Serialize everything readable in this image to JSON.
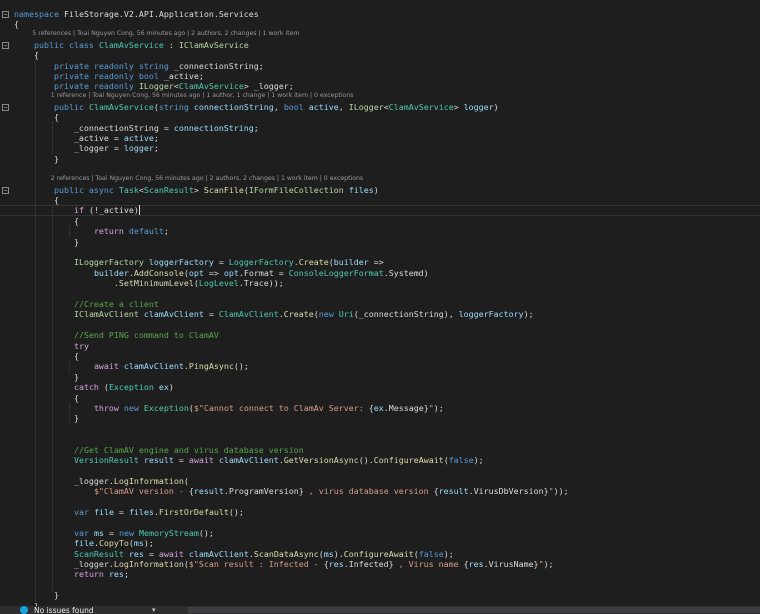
{
  "editor": {
    "lines": [
      [
        [
          "kw",
          "namespace"
        ],
        [
          "text",
          " FileStorage.V2.API.Application.Services"
        ]
      ],
      [
        [
          "text",
          "{"
        ]
      ],
      [
        [
          "text",
          "    "
        ],
        [
          "kw",
          "public class"
        ],
        [
          "text",
          " "
        ],
        [
          "type",
          "ClamAvService"
        ],
        [
          "text",
          " : "
        ],
        [
          "iface",
          "IClamAvService"
        ]
      ],
      [
        [
          "text",
          "    {"
        ]
      ],
      [
        [
          "text",
          "        "
        ],
        [
          "kw",
          "private readonly string"
        ],
        [
          "text",
          " _connectionString;"
        ]
      ],
      [
        [
          "text",
          "        "
        ],
        [
          "kw",
          "private readonly bool"
        ],
        [
          "text",
          " _active;"
        ]
      ],
      [
        [
          "text",
          "        "
        ],
        [
          "kw",
          "private readonly"
        ],
        [
          "text",
          " "
        ],
        [
          "iface",
          "ILogger"
        ],
        [
          "text",
          "<"
        ],
        [
          "type",
          "ClamAvService"
        ],
        [
          "text",
          "> _logger;"
        ]
      ],
      [
        [
          "text",
          "        "
        ],
        [
          "kw",
          "public"
        ],
        [
          "text",
          " "
        ],
        [
          "type",
          "ClamAvService"
        ],
        [
          "text",
          "("
        ],
        [
          "kw",
          "string"
        ],
        [
          "text",
          " "
        ],
        [
          "param",
          "connectionString"
        ],
        [
          "text",
          ", "
        ],
        [
          "kw",
          "bool"
        ],
        [
          "text",
          " "
        ],
        [
          "param",
          "active"
        ],
        [
          "text",
          ", "
        ],
        [
          "iface",
          "ILogger"
        ],
        [
          "text",
          "<"
        ],
        [
          "type",
          "ClamAvService"
        ],
        [
          "text",
          "> "
        ],
        [
          "param",
          "logger"
        ],
        [
          "text",
          ")"
        ]
      ],
      [
        [
          "text",
          "        {"
        ]
      ],
      [
        [
          "text",
          "            _connectionString = "
        ],
        [
          "param",
          "connectionString"
        ],
        [
          "text",
          ";"
        ]
      ],
      [
        [
          "text",
          "            _active = "
        ],
        [
          "param",
          "active"
        ],
        [
          "text",
          ";"
        ]
      ],
      [
        [
          "text",
          "            _logger = "
        ],
        [
          "param",
          "logger"
        ],
        [
          "text",
          ";"
        ]
      ],
      [
        [
          "text",
          "        }"
        ]
      ],
      [
        [
          "text",
          ""
        ]
      ],
      [
        [
          "text",
          "        "
        ],
        [
          "kw",
          "public async"
        ],
        [
          "text",
          " "
        ],
        [
          "type",
          "Task"
        ],
        [
          "text",
          "<"
        ],
        [
          "type",
          "ScanResult"
        ],
        [
          "text",
          "> "
        ],
        [
          "method",
          "ScanFile"
        ],
        [
          "text",
          "("
        ],
        [
          "iface",
          "IFormFileCollection"
        ],
        [
          "text",
          " "
        ],
        [
          "param",
          "files"
        ],
        [
          "text",
          ")"
        ]
      ],
      [
        [
          "text",
          "        {"
        ]
      ],
      [
        [
          "text",
          "            "
        ],
        [
          "ctl",
          "if"
        ],
        [
          "text",
          " (!_active)"
        ]
      ],
      [
        [
          "text",
          "            {"
        ]
      ],
      [
        [
          "text",
          "                "
        ],
        [
          "ctl",
          "return"
        ],
        [
          "text",
          " "
        ],
        [
          "kw",
          "default"
        ],
        [
          "text",
          ";"
        ]
      ],
      [
        [
          "text",
          "            }"
        ]
      ],
      [
        [
          "text",
          ""
        ]
      ],
      [
        [
          "text",
          "            "
        ],
        [
          "iface",
          "ILoggerFactory"
        ],
        [
          "text",
          " "
        ],
        [
          "param",
          "loggerFactory"
        ],
        [
          "text",
          " = "
        ],
        [
          "type",
          "LoggerFactory"
        ],
        [
          "text",
          "."
        ],
        [
          "method",
          "Create"
        ],
        [
          "text",
          "("
        ],
        [
          "param",
          "builder"
        ],
        [
          "text",
          " =>"
        ]
      ],
      [
        [
          "text",
          "                "
        ],
        [
          "param",
          "builder"
        ],
        [
          "text",
          "."
        ],
        [
          "method",
          "AddConsole"
        ],
        [
          "text",
          "("
        ],
        [
          "param",
          "opt"
        ],
        [
          "text",
          " => "
        ],
        [
          "param",
          "opt"
        ],
        [
          "text",
          ".Format = "
        ],
        [
          "type",
          "ConsoleLoggerFormat"
        ],
        [
          "text",
          ".Systemd)"
        ]
      ],
      [
        [
          "text",
          "                    ."
        ],
        [
          "method",
          "SetMinimumLevel"
        ],
        [
          "text",
          "("
        ],
        [
          "type",
          "LogLevel"
        ],
        [
          "text",
          ".Trace));"
        ]
      ],
      [
        [
          "text",
          ""
        ]
      ],
      [
        [
          "text",
          "            "
        ],
        [
          "cmt",
          "//Create a client"
        ]
      ],
      [
        [
          "text",
          "            "
        ],
        [
          "iface",
          "IClamAvClient"
        ],
        [
          "text",
          " "
        ],
        [
          "param",
          "clamAvClient"
        ],
        [
          "text",
          " = "
        ],
        [
          "type",
          "ClamAvClient"
        ],
        [
          "text",
          "."
        ],
        [
          "method",
          "Create"
        ],
        [
          "text",
          "("
        ],
        [
          "kw",
          "new"
        ],
        [
          "text",
          " "
        ],
        [
          "type",
          "Uri"
        ],
        [
          "text",
          "(_connectionString), "
        ],
        [
          "param",
          "loggerFactory"
        ],
        [
          "text",
          ");"
        ]
      ],
      [
        [
          "text",
          ""
        ]
      ],
      [
        [
          "text",
          "            "
        ],
        [
          "cmt",
          "//Send PING command to ClamAV"
        ]
      ],
      [
        [
          "text",
          "            "
        ],
        [
          "ctl",
          "try"
        ]
      ],
      [
        [
          "text",
          "            {"
        ]
      ],
      [
        [
          "text",
          "                "
        ],
        [
          "ctl",
          "await"
        ],
        [
          "text",
          " "
        ],
        [
          "param",
          "clamAvClient"
        ],
        [
          "text",
          "."
        ],
        [
          "method",
          "PingAsync"
        ],
        [
          "text",
          "();"
        ]
      ],
      [
        [
          "text",
          "            }"
        ]
      ],
      [
        [
          "text",
          "            "
        ],
        [
          "ctl",
          "catch"
        ],
        [
          "text",
          " ("
        ],
        [
          "type",
          "Exception"
        ],
        [
          "text",
          " "
        ],
        [
          "param",
          "ex"
        ],
        [
          "text",
          ")"
        ]
      ],
      [
        [
          "text",
          "            {"
        ]
      ],
      [
        [
          "text",
          "                "
        ],
        [
          "ctl",
          "throw"
        ],
        [
          "text",
          " "
        ],
        [
          "kw",
          "new"
        ],
        [
          "text",
          " "
        ],
        [
          "type",
          "Exception"
        ],
        [
          "text",
          "("
        ],
        [
          "str",
          "$\"Cannot connect to ClamAv Server: "
        ],
        [
          "text",
          "{"
        ],
        [
          "param",
          "ex"
        ],
        [
          "text",
          ".Message}"
        ],
        [
          "str",
          "\""
        ],
        [
          "text",
          ");"
        ]
      ],
      [
        [
          "text",
          "            }"
        ]
      ],
      [
        [
          "text",
          ""
        ]
      ],
      [
        [
          "text",
          ""
        ]
      ],
      [
        [
          "text",
          "            "
        ],
        [
          "cmt",
          "//Get ClamAV engine and virus database version"
        ]
      ],
      [
        [
          "text",
          "            "
        ],
        [
          "type",
          "VersionResult"
        ],
        [
          "text",
          " "
        ],
        [
          "param",
          "result"
        ],
        [
          "text",
          " = "
        ],
        [
          "ctl",
          "await"
        ],
        [
          "text",
          " "
        ],
        [
          "param",
          "clamAvClient"
        ],
        [
          "text",
          "."
        ],
        [
          "method",
          "GetVersionAsync"
        ],
        [
          "text",
          "()."
        ],
        [
          "method",
          "ConfigureAwait"
        ],
        [
          "text",
          "("
        ],
        [
          "kw",
          "false"
        ],
        [
          "text",
          ");"
        ]
      ],
      [
        [
          "text",
          ""
        ]
      ],
      [
        [
          "text",
          "            _logger."
        ],
        [
          "method",
          "LogInformation"
        ],
        [
          "text",
          "("
        ]
      ],
      [
        [
          "text",
          "                "
        ],
        [
          "str",
          "$\"ClamAV version - "
        ],
        [
          "text",
          "{"
        ],
        [
          "param",
          "result"
        ],
        [
          "text",
          ".ProgramVersion}"
        ],
        [
          "str",
          " , virus database version "
        ],
        [
          "text",
          "{"
        ],
        [
          "param",
          "result"
        ],
        [
          "text",
          ".VirusDbVersion}"
        ],
        [
          "str",
          "\""
        ],
        [
          "text",
          "));"
        ]
      ],
      [
        [
          "text",
          ""
        ]
      ],
      [
        [
          "text",
          "            "
        ],
        [
          "kw",
          "var"
        ],
        [
          "text",
          " "
        ],
        [
          "param",
          "file"
        ],
        [
          "text",
          " = "
        ],
        [
          "param",
          "files"
        ],
        [
          "text",
          "."
        ],
        [
          "method",
          "FirstOrDefault"
        ],
        [
          "text",
          "();"
        ]
      ],
      [
        [
          "text",
          ""
        ]
      ],
      [
        [
          "text",
          "            "
        ],
        [
          "kw",
          "var"
        ],
        [
          "text",
          " "
        ],
        [
          "param",
          "ms"
        ],
        [
          "text",
          " = "
        ],
        [
          "kw",
          "new"
        ],
        [
          "text",
          " "
        ],
        [
          "type",
          "MemoryStream"
        ],
        [
          "text",
          "();"
        ]
      ],
      [
        [
          "text",
          "            "
        ],
        [
          "param",
          "file"
        ],
        [
          "text",
          "."
        ],
        [
          "method",
          "CopyTo"
        ],
        [
          "text",
          "("
        ],
        [
          "param",
          "ms"
        ],
        [
          "text",
          ");"
        ]
      ],
      [
        [
          "text",
          "            "
        ],
        [
          "type",
          "ScanResult"
        ],
        [
          "text",
          " "
        ],
        [
          "param",
          "res"
        ],
        [
          "text",
          " = "
        ],
        [
          "ctl",
          "await"
        ],
        [
          "text",
          " "
        ],
        [
          "param",
          "clamAvClient"
        ],
        [
          "text",
          "."
        ],
        [
          "method",
          "ScanDataAsync"
        ],
        [
          "text",
          "("
        ],
        [
          "param",
          "ms"
        ],
        [
          "text",
          ")."
        ],
        [
          "method",
          "ConfigureAwait"
        ],
        [
          "text",
          "("
        ],
        [
          "kw",
          "false"
        ],
        [
          "text",
          ");"
        ]
      ],
      [
        [
          "text",
          "            _logger."
        ],
        [
          "method",
          "LogInformation"
        ],
        [
          "text",
          "("
        ],
        [
          "str",
          "$\"Scan result : Infected - "
        ],
        [
          "text",
          "{"
        ],
        [
          "param",
          "res"
        ],
        [
          "text",
          ".Infected}"
        ],
        [
          "str",
          " , Virus name "
        ],
        [
          "text",
          "{"
        ],
        [
          "param",
          "res"
        ],
        [
          "text",
          ".VirusName}"
        ],
        [
          "str",
          "\""
        ],
        [
          "text",
          ");"
        ]
      ],
      [
        [
          "text",
          "            "
        ],
        [
          "ctl",
          "return"
        ],
        [
          "text",
          " "
        ],
        [
          "param",
          "res"
        ],
        [
          "text",
          ";"
        ]
      ],
      [
        [
          "text",
          ""
        ]
      ],
      [
        [
          "text",
          "        }"
        ]
      ],
      [
        [
          "text",
          "    }"
        ]
      ]
    ],
    "codelens": [
      "5 references | Toai Nguyen Cong, 56 minutes ago | 2 authors, 2 changes | 1 work item",
      "1 reference | Toai Nguyen Cong, 56 minutes ago | 1 author, 1 change | 1 work item | 0 exceptions",
      "2 references | Toai Nguyen Cong, 56 minutes ago | 2 authors, 2 changes | 1 work item | 0 exceptions"
    ]
  },
  "statusbar": {
    "issues_text": "No issues found",
    "issues_icon": "check-circle-icon",
    "tool_icon": "brush-icon",
    "tool_label": "▾"
  },
  "colors": {
    "background": "#1e1e1e",
    "keyword": "#569cd6",
    "control": "#d8a0df",
    "type": "#4ec9b0",
    "interface": "#b8d7a3",
    "method": "#dcdcaa",
    "parameter": "#9cdcfe",
    "string": "#d69d85",
    "comment": "#57a64a"
  }
}
